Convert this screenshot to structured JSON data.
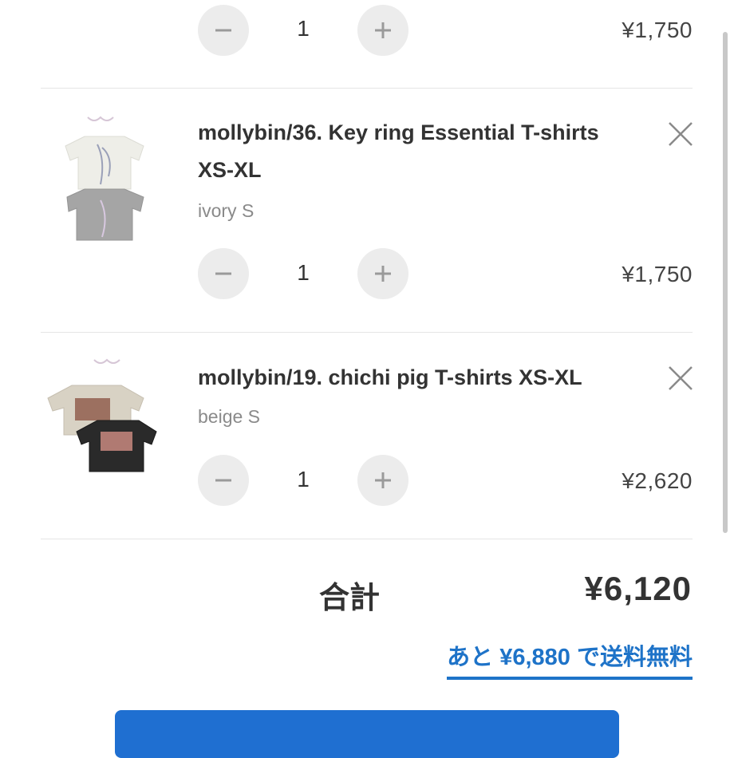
{
  "items": [
    {
      "quantity": "1",
      "price": "¥1,750"
    },
    {
      "title_line1": "mollybin/36. Key ring Essential T-shirts",
      "title_line2": "XS-XL",
      "variant": "ivory S",
      "quantity": "1",
      "price": "¥1,750"
    },
    {
      "title_line1": "mollybin/19. chichi pig T-shirts XS-XL",
      "variant": "beige S",
      "quantity": "1",
      "price": "¥2,620"
    }
  ],
  "summary": {
    "total_label": "合計",
    "total_value": "¥6,120",
    "free_shipping_text": "あと ¥6,880 で送料無料"
  },
  "colors": {
    "accent": "#1e73c8",
    "checkout_button": "#1f6fd1",
    "qty_button_bg": "#ececec"
  }
}
